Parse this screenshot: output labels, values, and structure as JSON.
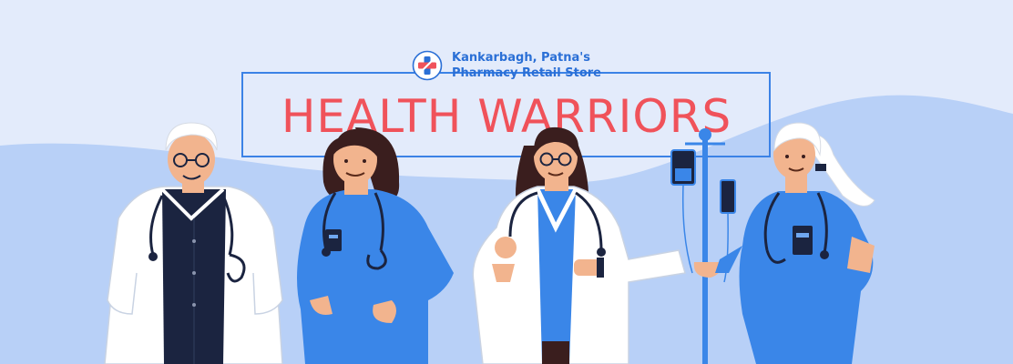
{
  "brand": {
    "line1": "Kankarbagh, Patna's",
    "line2": "Pharmacy Retail Store"
  },
  "headline": "HEALTH WARRIORS",
  "colors": {
    "background": "#e3ebfb",
    "wave": "#b8d0f7",
    "brand_blue": "#2a6fd6",
    "headline_red": "#f0525a",
    "scrub_blue": "#3a86e8",
    "navy": "#1b2440",
    "skin": "#f2b48e"
  },
  "illustration": {
    "figures": [
      "senior-male-doctor",
      "female-nurse",
      "female-doctor",
      "iv-drip-stand",
      "senior-female-nurse"
    ]
  }
}
